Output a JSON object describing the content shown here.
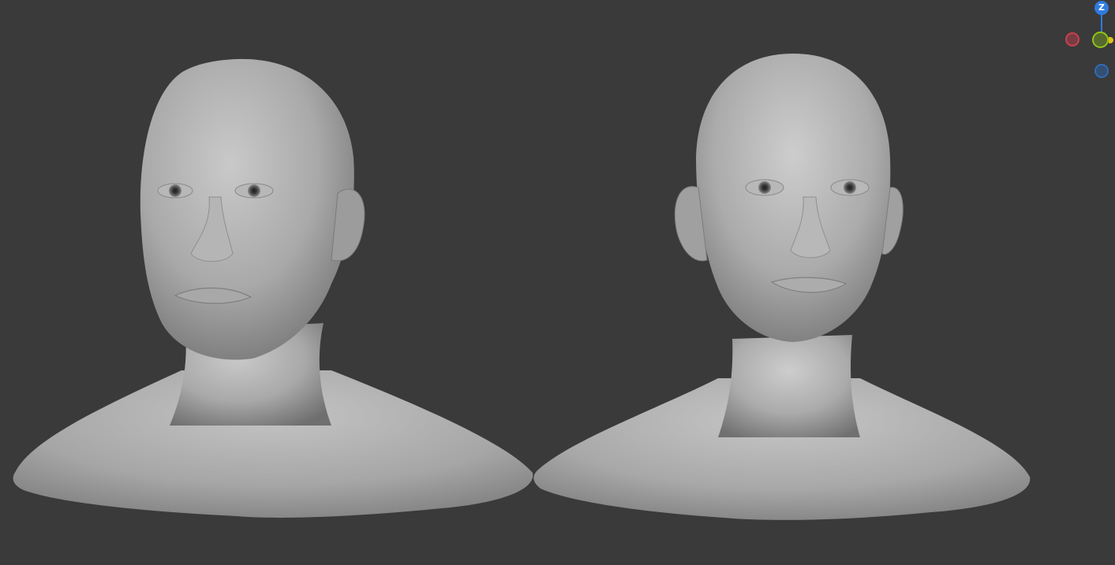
{
  "viewport": {
    "background": "#3a3a3a",
    "models": [
      {
        "name": "male-head-bust",
        "shading": "matcap-gray"
      },
      {
        "name": "female-head-bust",
        "shading": "matcap-gray"
      }
    ]
  },
  "gizmo": {
    "z_label": "Z",
    "colors": {
      "z_axis": "#2f7be0",
      "x_axis_negative": "#c9414f",
      "y_axis": "#8fc41a",
      "z_axis_negative": "#2f6bb5"
    }
  }
}
